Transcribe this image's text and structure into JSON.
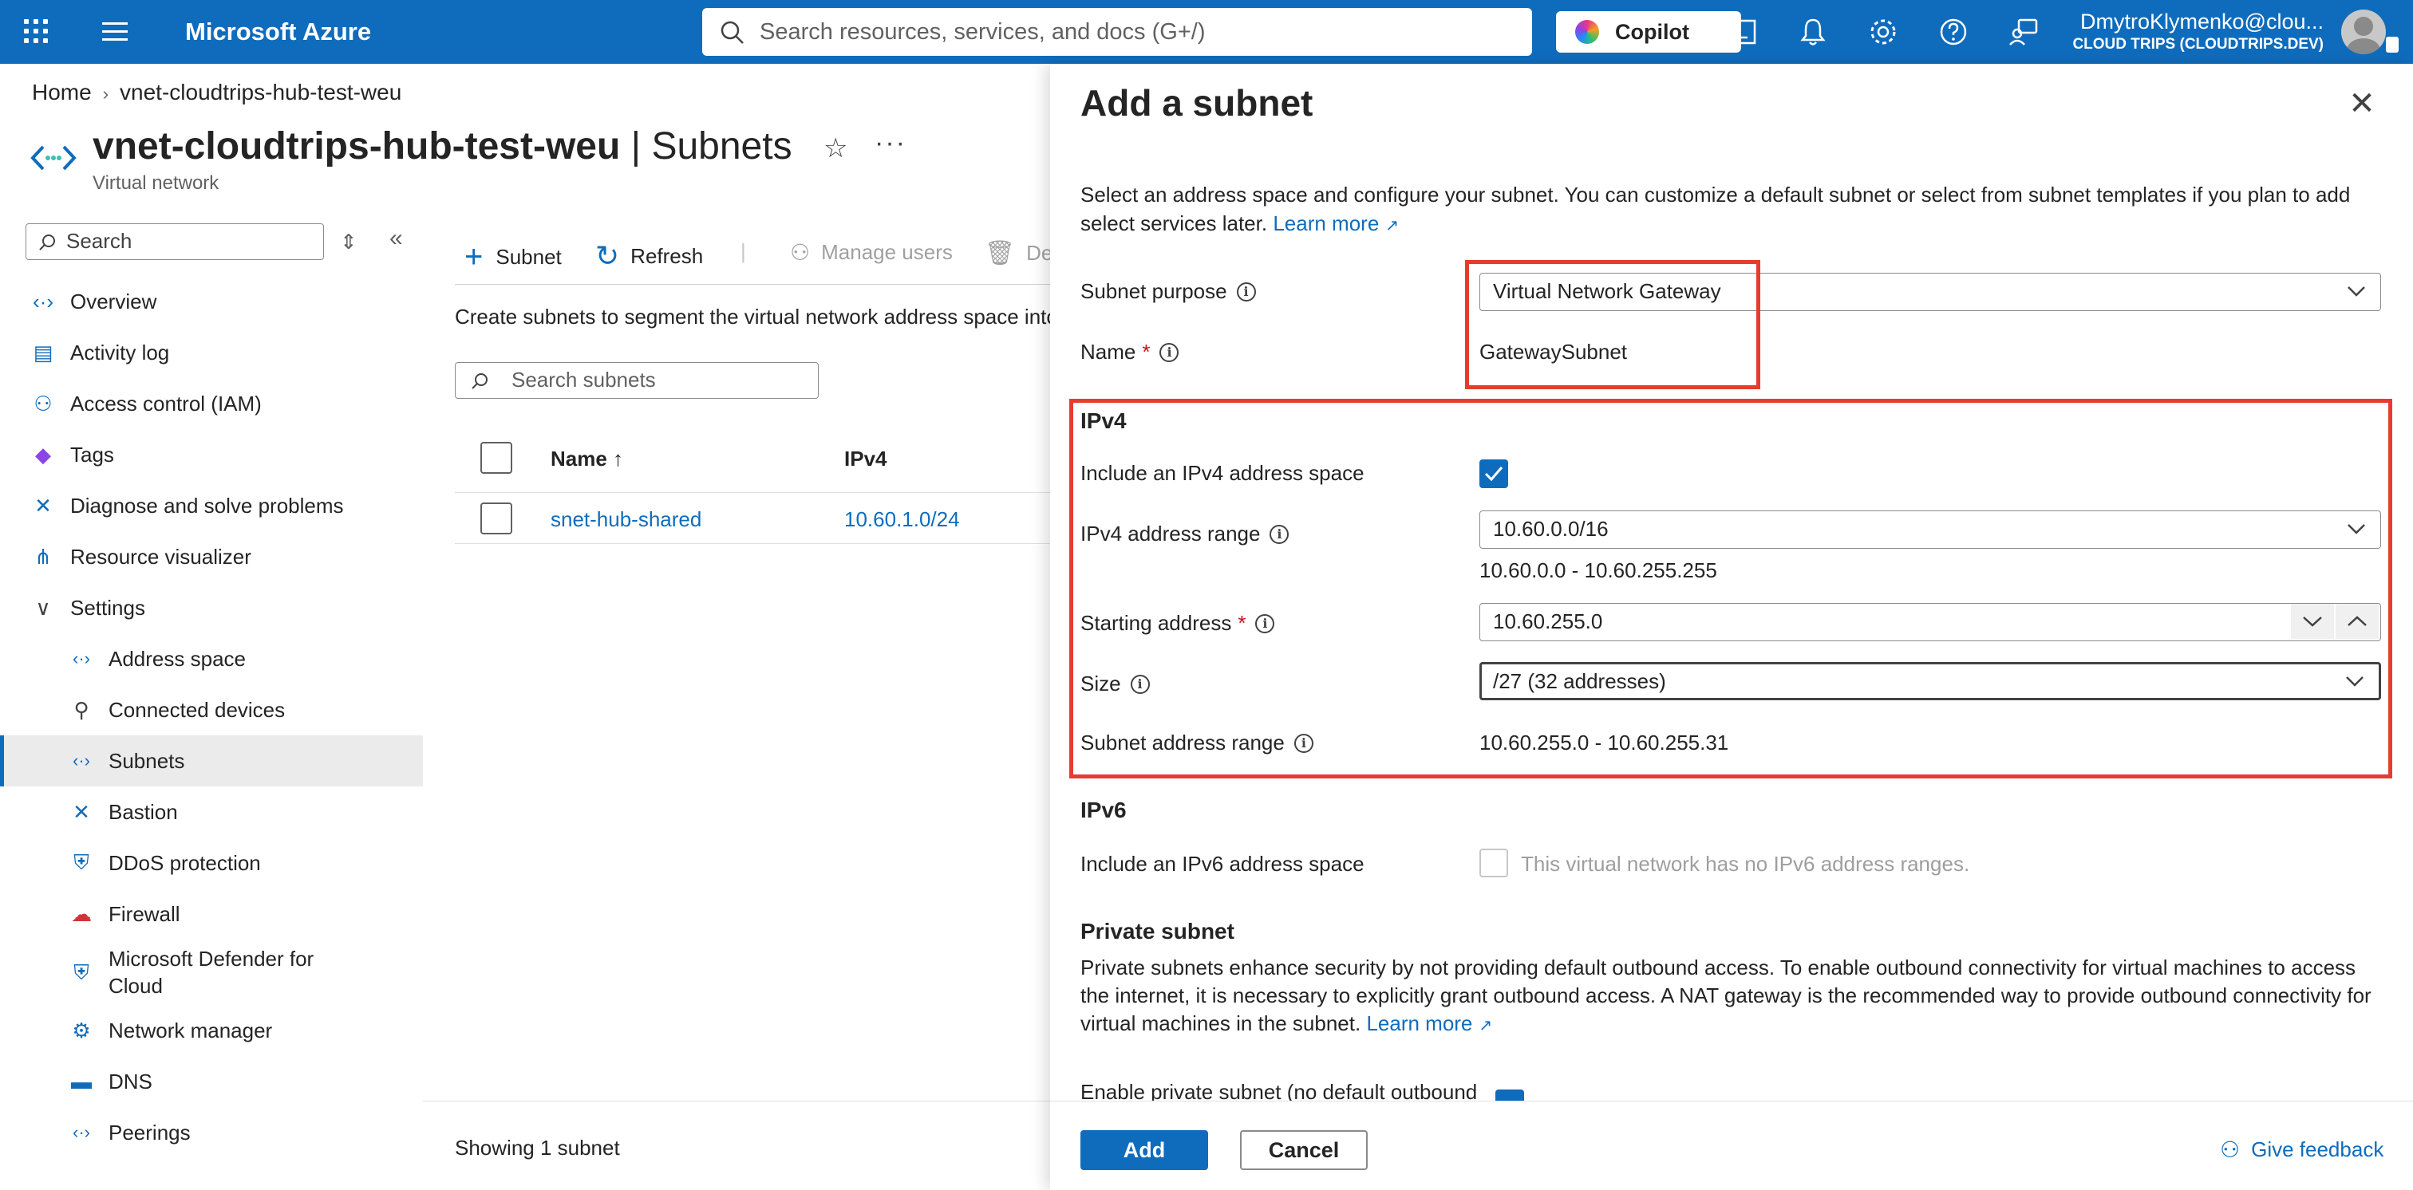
{
  "topbar": {
    "brand": "Microsoft Azure",
    "search_placeholder": "Search resources, services, and docs (G+/)",
    "copilot_label": "Copilot",
    "account_name": "DmytroKlymenko@clou...",
    "tenant": "CLOUD TRIPS (CLOUDTRIPS.DEV)"
  },
  "breadcrumb": {
    "home": "Home",
    "resource": "vnet-cloudtrips-hub-test-weu"
  },
  "header": {
    "resource_name": "vnet-cloudtrips-hub-test-weu",
    "separator": " | ",
    "blade": "Subnets",
    "subtitle": "Virtual network",
    "star": "☆",
    "more": "···"
  },
  "sidebar": {
    "search_placeholder": "Search",
    "items": [
      {
        "label": "Overview",
        "icon": "overview-icon",
        "glyph": "‹·›",
        "color": "#0f6cbd"
      },
      {
        "label": "Activity log",
        "icon": "activity-log-icon",
        "glyph": "▤",
        "color": "#0f6cbd"
      },
      {
        "label": "Access control (IAM)",
        "icon": "iam-icon",
        "glyph": "👥",
        "color": "#0f6cbd"
      },
      {
        "label": "Tags",
        "icon": "tag-icon",
        "glyph": "◆",
        "color": "#8a45e6"
      },
      {
        "label": "Diagnose and solve problems",
        "icon": "wrench-icon",
        "glyph": "✕",
        "color": "#0f6cbd"
      },
      {
        "label": "Resource visualizer",
        "icon": "visualizer-icon",
        "glyph": "⋔",
        "color": "#0f6cbd"
      },
      {
        "label": "Settings",
        "icon": "chevron-down-icon",
        "glyph": "∨",
        "color": "#424242"
      },
      {
        "label": "Address space",
        "icon": "address-space-icon",
        "glyph": "‹·›",
        "color": "#0f6cbd"
      },
      {
        "label": "Connected devices",
        "icon": "plug-icon",
        "glyph": "⚲",
        "color": "#424242"
      },
      {
        "label": "Subnets",
        "icon": "subnet-icon",
        "glyph": "‹·›",
        "color": "#0f6cbd"
      },
      {
        "label": "Bastion",
        "icon": "bastion-icon",
        "glyph": "✕",
        "color": "#0f6cbd"
      },
      {
        "label": "DDoS protection",
        "icon": "shield-icon",
        "glyph": "⛨",
        "color": "#0f6cbd"
      },
      {
        "label": "Firewall",
        "icon": "firewall-icon",
        "glyph": "☁",
        "color": "#d13438"
      },
      {
        "label": "Microsoft Defender for",
        "label2": "Cloud",
        "icon": "defender-icon",
        "glyph": "⛨",
        "color": "#0f6cbd"
      },
      {
        "label": "Network manager",
        "icon": "network-manager-icon",
        "glyph": "⚙",
        "color": "#0f6cbd"
      },
      {
        "label": "DNS",
        "icon": "dns-icon",
        "glyph": "▬",
        "color": "#0f6cbd"
      },
      {
        "label": "Peerings",
        "icon": "peerings-icon",
        "glyph": "‹·›",
        "color": "#0f6cbd"
      }
    ]
  },
  "commands": {
    "add_subnet": "Subnet",
    "refresh": "Refresh",
    "manage_users": "Manage users",
    "delete": "De"
  },
  "content": {
    "intro": "Create subnets to segment the virtual network address space into",
    "search_placeholder": "Search subnets",
    "columns": {
      "name": "Name ↑",
      "ipv4": "IPv4"
    },
    "rows": [
      {
        "name": "snet-hub-shared",
        "ipv4": "10.60.1.0/24"
      }
    ],
    "showing": "Showing 1 subnet"
  },
  "panel": {
    "title": "Add a subnet",
    "description": "Select an address space and configure your subnet. You can customize a default subnet or select from subnet templates if you plan to add select services later.",
    "learn_more": "Learn more",
    "subnet_purpose_label": "Subnet purpose",
    "subnet_purpose_value": "Virtual Network Gateway",
    "name_label": "Name",
    "name_value": "GatewaySubnet",
    "required_mark": "*",
    "ipv4_section": "IPv4",
    "include_ipv4_label": "Include an IPv4 address space",
    "include_ipv4_checked": true,
    "ipv4_range_label": "IPv4 address range",
    "ipv4_range_value": "10.60.0.0/16",
    "ipv4_range_span": "10.60.0.0 - 10.60.255.255",
    "starting_address_label": "Starting address",
    "starting_address_value": "10.60.255.0",
    "size_label": "Size",
    "size_value": "/27 (32 addresses)",
    "subnet_range_label": "Subnet address range",
    "subnet_range_value": "10.60.255.0 - 10.60.255.31",
    "ipv6_section": "IPv6",
    "include_ipv6_label": "Include an IPv6 address space",
    "include_ipv6_checked": false,
    "ipv6_disabled_text": "This virtual network has no IPv6 address ranges.",
    "private_section": "Private subnet",
    "private_desc": "Private subnets enhance security by not providing default outbound access. To enable outbound connectivity for virtual machines to access the internet, it is necessary to explicitly grant outbound access. A NAT gateway is the recommended way to provide outbound connectivity for virtual machines in the subnet.",
    "private_learn_more": "Learn more",
    "enable_private_label": "Enable private subnet (no default outbound",
    "add_button": "Add",
    "cancel_button": "Cancel",
    "feedback": "Give feedback",
    "close": "✕"
  },
  "colors": {
    "accent": "#0f6cbd",
    "highlight": "#e63c2f"
  }
}
